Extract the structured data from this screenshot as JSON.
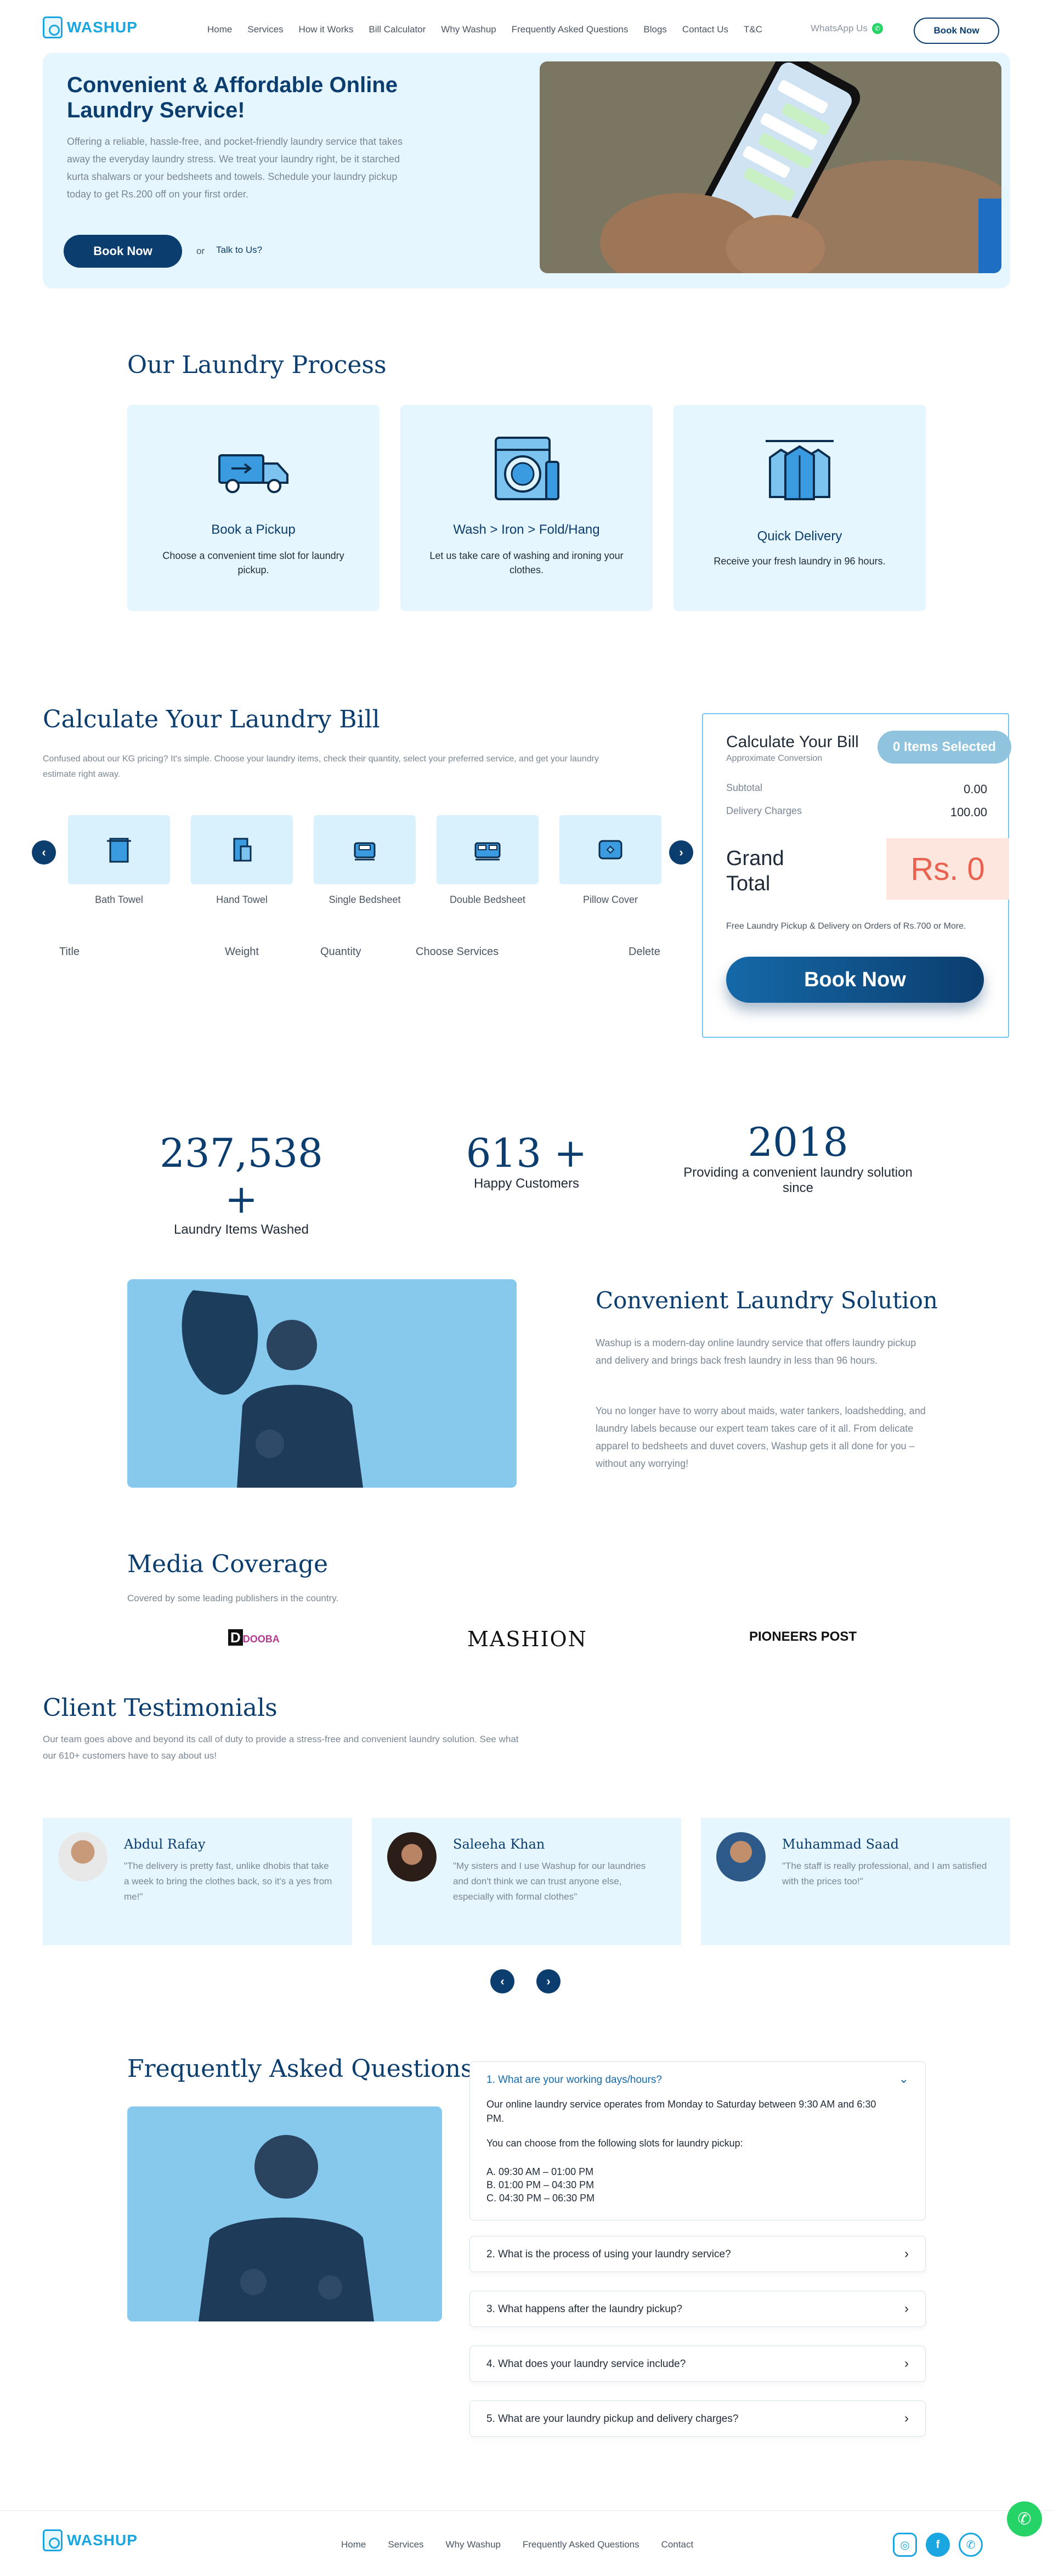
{
  "header": {
    "logo_text": "WASHUP",
    "nav": [
      "Home",
      "Services",
      "How it Works",
      "Bill Calculator",
      "Why Washup",
      "Frequently Asked Questions",
      "Blogs",
      "Contact Us",
      "T&C"
    ],
    "whatsapp_label": "WhatsApp Us",
    "book_now": "Book Now"
  },
  "hero": {
    "title": "Convenient & Affordable Online Laundry Service!",
    "description": "Offering a reliable, hassle-free, and pocket-friendly laundry service that takes away the everyday laundry stress. We treat your laundry right, be it starched kurta shalwars or your bedsheets and towels. Schedule your laundry pickup today to get Rs.200 off on your first order.",
    "book_now": "Book Now",
    "or": "or",
    "talk": "Talk to Us?"
  },
  "process": {
    "title": "Our Laundry Process",
    "cards": [
      {
        "title": "Book a Pickup",
        "desc": "Choose a convenient time slot for laundry pickup.",
        "icon": "truck-icon"
      },
      {
        "title": "Wash > Iron > Fold/Hang",
        "desc": "Let us take care of washing and ironing your clothes.",
        "icon": "washing-machine-icon"
      },
      {
        "title": "Quick Delivery",
        "desc": "Receive your fresh laundry in 96 hours.",
        "icon": "shirts-hanger-icon"
      }
    ]
  },
  "calculator": {
    "title": "Calculate Your Laundry Bill",
    "description": "Confused about our KG pricing? It's simple. Choose your laundry items, check their quantity, select your preferred service, and get your laundry estimate right away.",
    "items": [
      "Bath Towel",
      "Hand Towel",
      "Single Bedsheet",
      "Double Bedsheet",
      "Pillow Cover"
    ],
    "table_headers": [
      "Title",
      "Weight",
      "Quantity",
      "Choose Services",
      "Delete"
    ],
    "bill": {
      "title": "Calculate Your Bill",
      "subtitle": "Approximate Conversion",
      "badge": "0 Items Selected",
      "subtotal_label": "Subtotal",
      "subtotal_value": "0.00",
      "delivery_label": "Delivery Charges",
      "delivery_value": "100.00",
      "grand_total_label": "Grand Total",
      "grand_total_value": "Rs. 0",
      "note": "Free Laundry Pickup & Delivery on Orders of Rs.700 or More.",
      "book_now": "Book Now"
    }
  },
  "stats": [
    {
      "number": "237,538 +",
      "label": "Laundry Items Washed"
    },
    {
      "number": "613 +",
      "label": "Happy Customers"
    },
    {
      "number": "2018",
      "label": "Providing a convenient laundry solution since"
    }
  ],
  "solution": {
    "title": "Convenient Laundry Solution",
    "p1": "Washup is a modern-day online laundry service that offers laundry pickup and delivery and brings back fresh laundry in less than 96 hours.",
    "p2": "You no longer have to worry about maids, water tankers, loadshedding, and laundry labels because our expert team takes care of it all. From delicate apparel to bedsheets and duvet covers, Washup gets it all done for you – without any worrying!"
  },
  "media": {
    "title": "Media Coverage",
    "subtitle": "Covered by some leading publishers in the country.",
    "logos": [
      "DOOBA",
      "MASHION",
      "PIONEERS POST"
    ]
  },
  "testimonials": {
    "title": "Client Testimonials",
    "subtitle": "Our team goes above and beyond its call of duty to provide a stress-free and convenient laundry solution. See what our 610+ customers have to say about us!",
    "items": [
      {
        "name": "Abdul Rafay",
        "quote": "\"The delivery is pretty fast, unlike dhobis that take a week to bring the clothes back, so it's a yes from me!\""
      },
      {
        "name": "Saleeha Khan",
        "quote": "\"My sisters and I use Washup for our laundries and don't think we can trust anyone else, especially with formal clothes\""
      },
      {
        "name": "Muhammad Saad",
        "quote": "\"The staff is really professional, and I am satisfied with the prices too!\""
      }
    ]
  },
  "faq": {
    "title": "Frequently Asked Questions",
    "open_question": "1. What are your working days/hours?",
    "open_answer_1": "Our online laundry service operates from Monday to Saturday between 9:30 AM and 6:30 PM.",
    "open_answer_2": "You can choose from the following slots for laundry pickup:",
    "slots": [
      "A. 09:30 AM – 01:00 PM",
      "B. 01:00 PM – 04:30 PM",
      "C. 04:30 PM – 06:30 PM"
    ],
    "questions": [
      "2. What is the process of using your laundry service?",
      "3. What happens after the laundry pickup?",
      "4. What does your laundry service include?",
      "5. What are your laundry pickup and delivery charges?"
    ]
  },
  "footer": {
    "logo_text": "WASHUP",
    "nav": [
      "Home",
      "Services",
      "Why Washup",
      "Frequently Asked Questions",
      "Contact"
    ]
  }
}
